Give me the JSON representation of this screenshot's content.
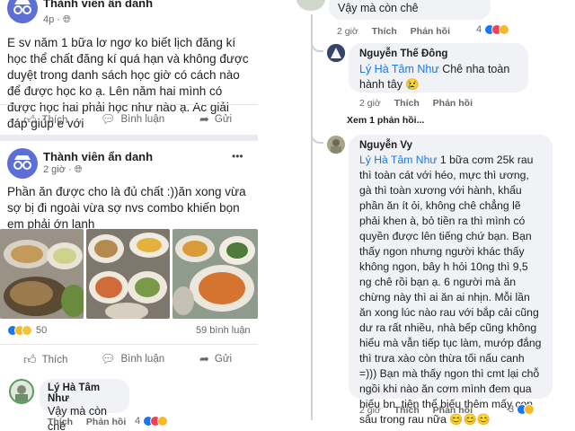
{
  "left": {
    "post1": {
      "author": "Thành viên ẩn danh",
      "time": "4p",
      "text": "E sv năm 1 bữa lơ ngơ ko biết lịch đăng kí học thể chất đăng kí quá hạn và không được duyệt trong danh sách học giờ có cách nào để được học ko ạ. Lên năm hai mình có được học hai phải học như nào ạ. Ac giải đáp giúp e với",
      "like": "Thích",
      "comment": "Bình luận",
      "share": "Gửi"
    },
    "post2": {
      "author": "Thành viên ẩn danh",
      "time": "2 giờ",
      "more": "•••",
      "text": "Phần ăn được cho là đủ chất :))ăn xong vừa sợ bị đi ngoài vừa sợ nvs combo khiến bọn em phải ớn lạnh",
      "reaction_count": "50",
      "comment_count": "59 bình luận",
      "like": "Thích",
      "comment": "Bình luận",
      "share": "Gửi"
    },
    "comment": {
      "author": "Lý Hà Tâm Như",
      "text": "Vậy mà còn chê",
      "like": "Thích",
      "reply": "Phản hồi",
      "count": "4"
    }
  },
  "right": {
    "top_comment": {
      "text": "Vậy mà còn chê",
      "time": "2 giờ",
      "like": "Thích",
      "reply": "Phản hồi",
      "count": "4"
    },
    "reply1": {
      "author": "Nguyễn Thế Đông",
      "tag": "Lý Hà Tâm Như",
      "text": " Chê nha toàn hành tây 😢",
      "time": "2 giờ",
      "like": "Thích",
      "reply": "Phản hồi"
    },
    "see_more": "Xem 1 phản hồi...",
    "reply2": {
      "author": "Nguyễn Vy",
      "tag": "Lý Hà Tâm Như",
      "text": " 1 bữa cơm 25k rau thì toàn cát với héo, mực thì ương, gà thì toàn xương với hành, khẩu phần ăn ít ỏi, không chê chẳng lẽ phải khen à, bỏ tiền ra thì mình có quyền được lên tiếng chứ bạn. Bạn thấy ngon nhưng người khác thấy không ngon, bây h hỏi 10ng thì 9,5 ng chê rồi bạn ạ. 6 người mà ăn chừng này thì ai ăn ai nhịn. Mỗi lần ăn xong lúc nào rau với bắp cải cũng dư ra rất nhiều, nhà bếp cũng không hiểu mà vẫn tiếp tục làm, mướp đắng thì trưa xào còn thừa tối nấu canh =))) Bạn mà thấy ngon thì cmt lại chỗ ngồi khi nào ăn cơm mình đem qua biếu bn, tiện thể biếu thêm mấy con sâu trong rau nữa 😊😊😊",
      "time": "2 giờ",
      "like": "Thích",
      "reply": "Phản hồi",
      "count": "3"
    }
  },
  "colors": {
    "facebook_blue": "#1877f2",
    "gray_text": "#65676b",
    "bubble": "#f0f2f5"
  }
}
